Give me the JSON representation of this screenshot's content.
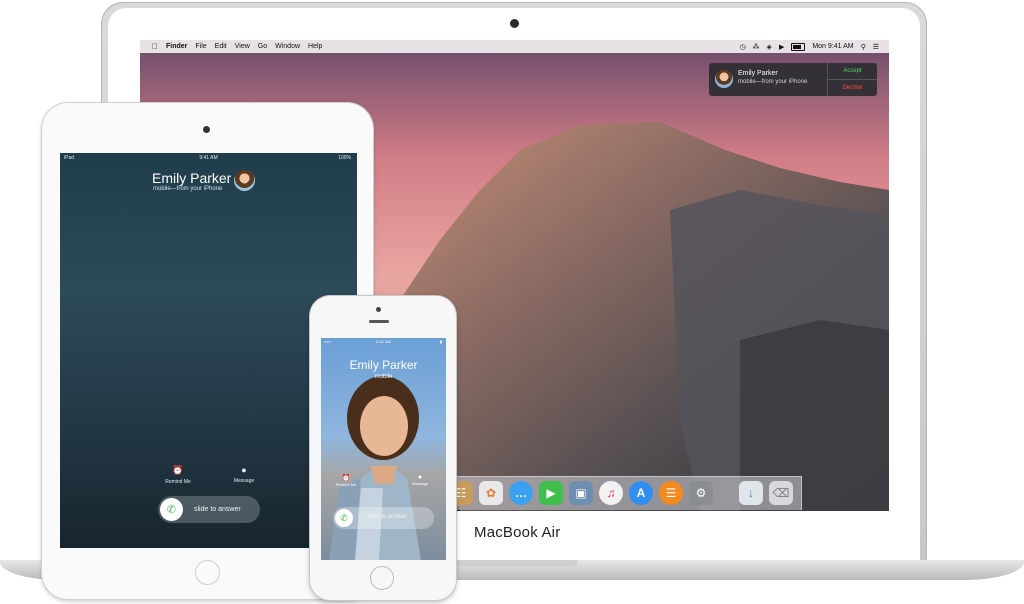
{
  "mac": {
    "label": "MacBook Air",
    "menubar": {
      "items": [
        "Finder",
        "File",
        "Edit",
        "View",
        "Go",
        "Window",
        "Help"
      ],
      "clock": "Mon 9:41 AM"
    },
    "notification": {
      "title": "Emily Parker",
      "subtitle": "mobile—from your iPhone",
      "accept": "Accept",
      "decline": "Decline"
    },
    "dock_icons": [
      "contacts-icon",
      "photos-icon",
      "messages-icon",
      "facetime-icon",
      "preview-icon",
      "itunes-icon",
      "app-store-icon",
      "ibooks-icon",
      "system-preferences-icon",
      "downloads-icon",
      "trash-icon"
    ]
  },
  "ipad": {
    "status": {
      "left": "iPad",
      "time": "9:41 AM",
      "battery": "100%"
    },
    "caller_name": "Emily Parker",
    "caller_sub": "mobile—from your iPhone",
    "remind_label": "Remind Me",
    "message_label": "Message",
    "slide_label": "slide to answer"
  },
  "iphone": {
    "status": {
      "time": "9:41 AM"
    },
    "caller_name": "Emily Parker",
    "caller_sub": "mobile",
    "remind_label": "Remind Me",
    "message_label": "Message",
    "slide_label": "slide to answer"
  }
}
